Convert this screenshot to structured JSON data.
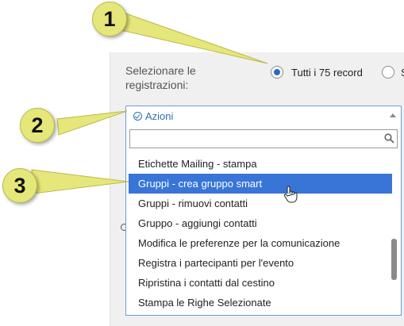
{
  "form": {
    "select_label": "Selezionare le registrazioni:",
    "radio_all_label": "Tutti i 75 record",
    "radio_all_checked": true,
    "radio_second_label": "S"
  },
  "dropdown": {
    "title": "Azioni",
    "search_value": "",
    "options": [
      "Etichette Mailing - stampa",
      "Gruppi - crea gruppo smart",
      "Gruppi - rimuovi contatti",
      "Gruppo - aggiungi contatti",
      "Modifica le preferenze per la comunicazione",
      "Registra i partecipanti per l'evento",
      "Ripristina i contatti dal cestino",
      "Stampa le Righe Selezionate"
    ],
    "highlighted_index": 1
  },
  "callouts": [
    "1",
    "2",
    "3"
  ],
  "colors": {
    "accent": "#3875d7",
    "callout_fill": "#e6e77a",
    "link_blue": "#2f6fb5"
  }
}
